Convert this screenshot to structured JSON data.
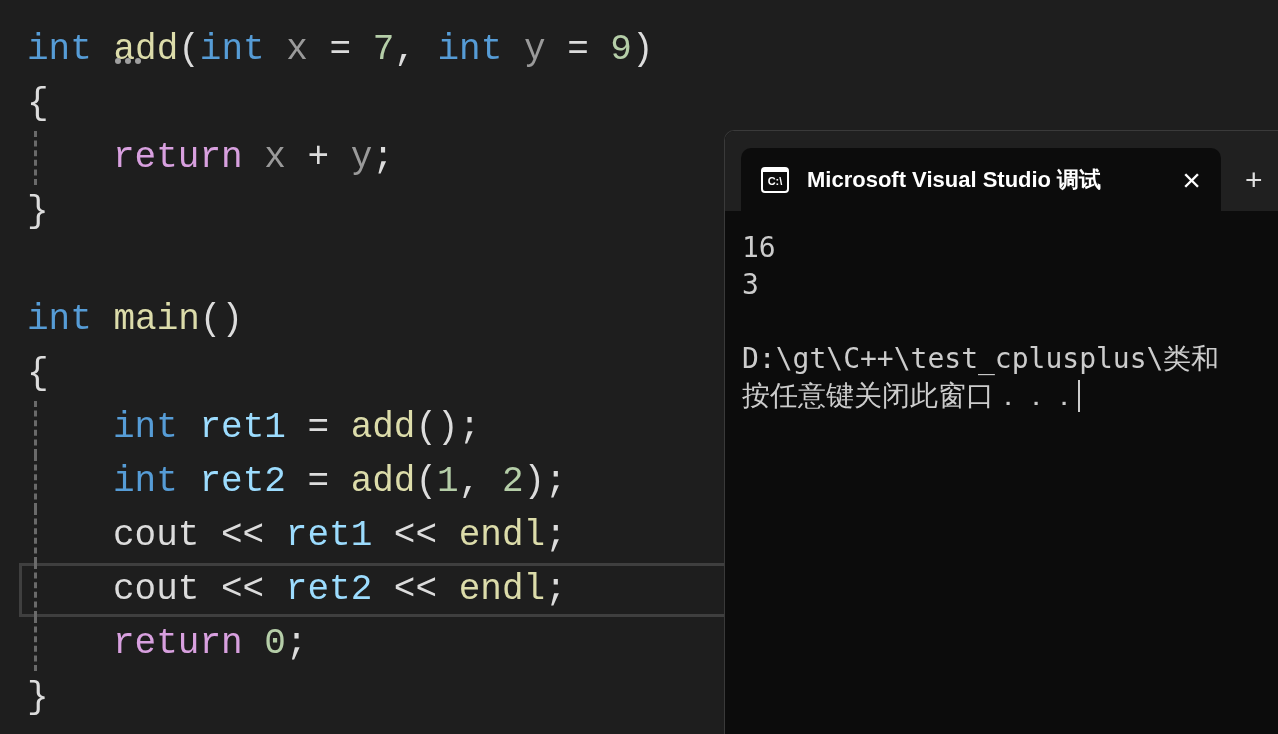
{
  "editor": {
    "functions": [
      {
        "header": [
          {
            "text": "int ",
            "kind": "keyword"
          },
          {
            "text": "add",
            "kind": "function",
            "hint": true
          },
          {
            "text": "("
          },
          {
            "text": "int ",
            "kind": "keyword"
          },
          {
            "text": "x",
            "kind": "param"
          },
          {
            "text": " = "
          },
          {
            "text": "7",
            "kind": "number"
          },
          {
            "text": ", "
          },
          {
            "text": "int ",
            "kind": "keyword"
          },
          {
            "text": "y",
            "kind": "param"
          },
          {
            "text": " = "
          },
          {
            "text": "9",
            "kind": "number"
          },
          {
            "text": ")"
          }
        ],
        "open": "{",
        "close": "}",
        "body": [
          {
            "current": false,
            "tokens": [
              {
                "text": "return ",
                "kind": "control"
              },
              {
                "text": "x",
                "kind": "param"
              },
              {
                "text": " + "
              },
              {
                "text": "y",
                "kind": "param"
              },
              {
                "text": ";"
              }
            ]
          }
        ]
      },
      {
        "header": [
          {
            "text": "int ",
            "kind": "keyword"
          },
          {
            "text": "main",
            "kind": "function"
          },
          {
            "text": "()"
          }
        ],
        "open": "{",
        "close": "}",
        "body": [
          {
            "current": false,
            "tokens": [
              {
                "text": "int ",
                "kind": "keyword"
              },
              {
                "text": "ret1",
                "kind": "local"
              },
              {
                "text": " = "
              },
              {
                "text": "add",
                "kind": "function"
              },
              {
                "text": "();"
              }
            ]
          },
          {
            "current": false,
            "tokens": [
              {
                "text": "int ",
                "kind": "keyword"
              },
              {
                "text": "ret2",
                "kind": "local"
              },
              {
                "text": " = "
              },
              {
                "text": "add",
                "kind": "function"
              },
              {
                "text": "("
              },
              {
                "text": "1",
                "kind": "number"
              },
              {
                "text": ", "
              },
              {
                "text": "2",
                "kind": "number"
              },
              {
                "text": ");"
              }
            ]
          },
          {
            "current": false,
            "tokens": [
              {
                "text": "cout << "
              },
              {
                "text": "ret1",
                "kind": "local"
              },
              {
                "text": " << "
              },
              {
                "text": "endl",
                "kind": "function"
              },
              {
                "text": ";"
              }
            ]
          },
          {
            "current": true,
            "tokens": [
              {
                "text": "cout << "
              },
              {
                "text": "ret2",
                "kind": "local"
              },
              {
                "text": " << "
              },
              {
                "text": "endl",
                "kind": "function"
              },
              {
                "text": ";"
              }
            ]
          },
          {
            "current": false,
            "tokens": [
              {
                "text": "return ",
                "kind": "control"
              },
              {
                "text": "0",
                "kind": "number"
              },
              {
                "text": ";"
              }
            ]
          }
        ]
      }
    ]
  },
  "terminal": {
    "tab": {
      "icon_text": "C:\\",
      "title": "Microsoft Visual Studio 调试",
      "close": "×",
      "new_tab": "+"
    },
    "output_lines": [
      "16",
      "3"
    ],
    "prompt_lines": [
      "D:\\gt\\C++\\test_cplusplus\\类和",
      "按任意键关闭此窗口．．．"
    ],
    "cursor": true
  }
}
